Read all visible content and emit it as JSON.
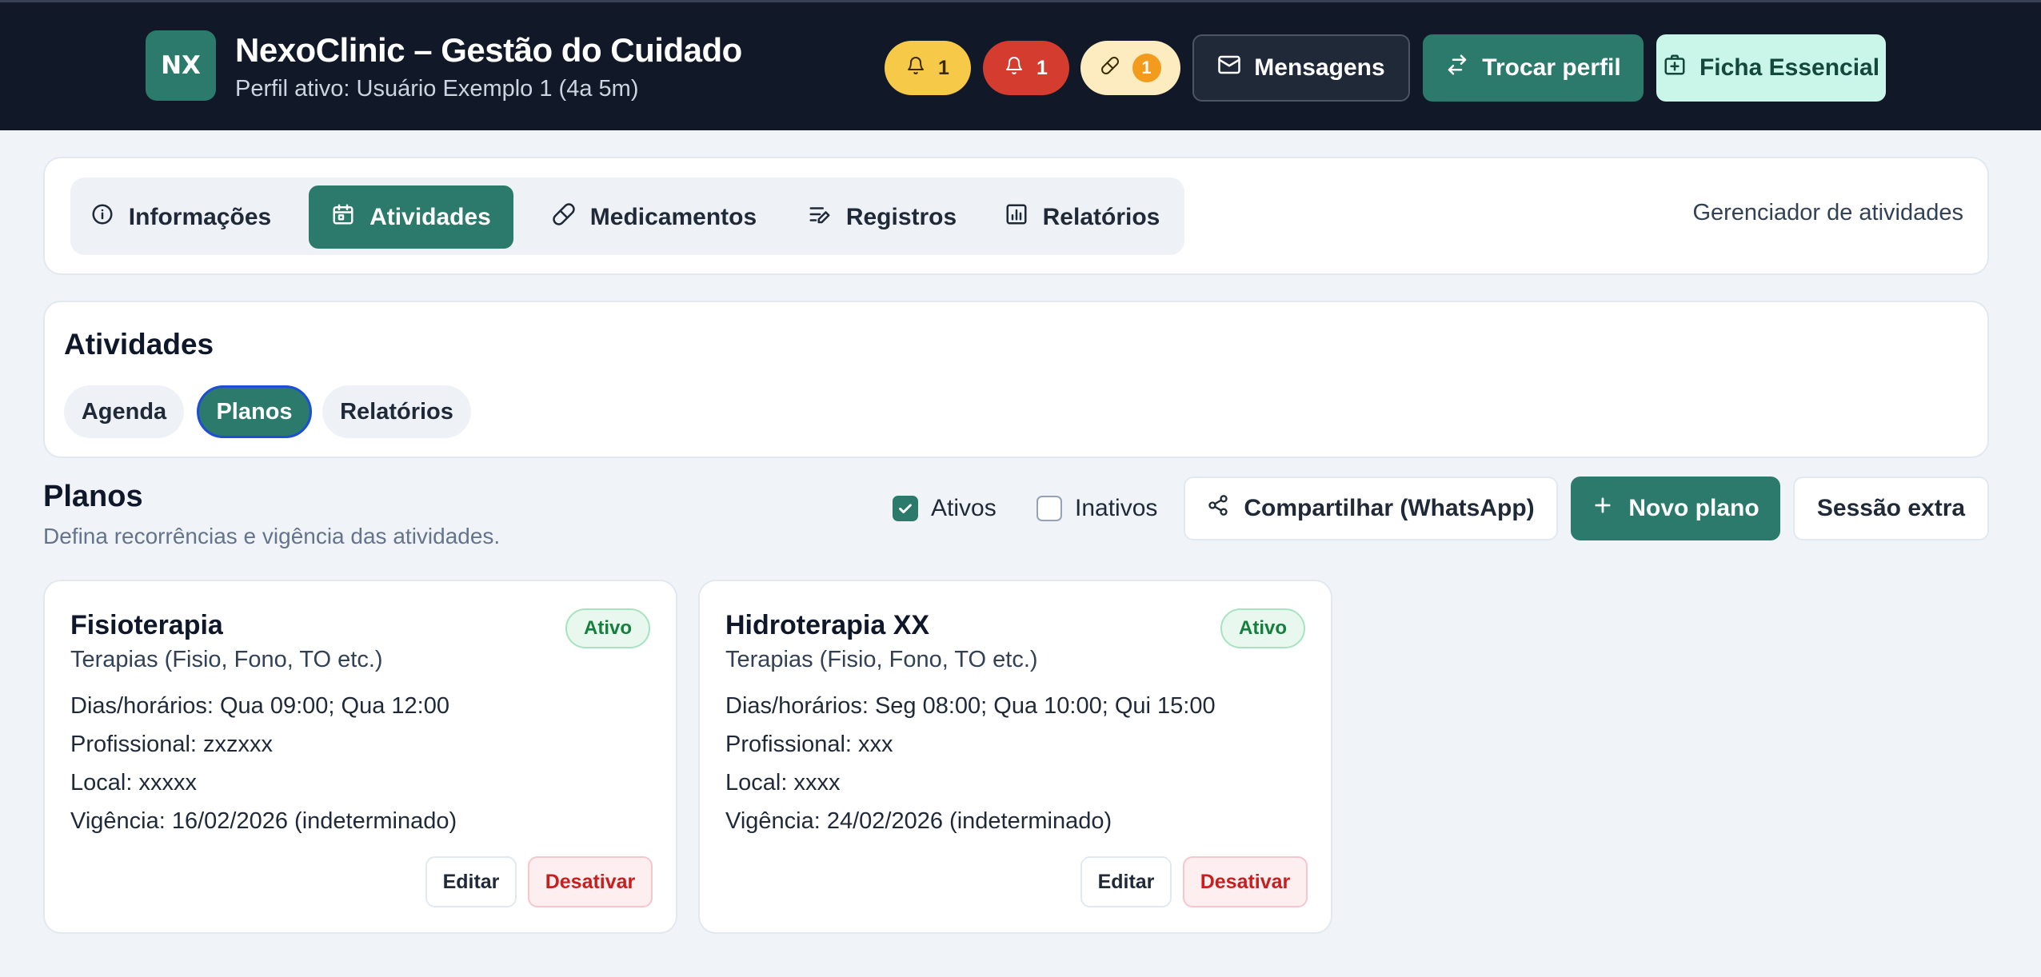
{
  "header": {
    "logo_text": "NX",
    "title": "NexoClinic – Gestão do Cuidado",
    "subtitle": "Perfil ativo: Usuário Exemplo 1 (4a 5m)",
    "alerts": [
      {
        "icon": "bell-icon",
        "count": "1",
        "color": "#f7c948"
      },
      {
        "icon": "bell-icon",
        "count": "1",
        "color": "#d43c30"
      },
      {
        "icon": "pill-icon",
        "count": "1",
        "color": "#fdecc0"
      }
    ],
    "messages_label": "Mensagens",
    "switch_profile_label": "Trocar perfil",
    "essential_sheet_label": "Ficha Essencial"
  },
  "nav": {
    "tabs": [
      {
        "label": "Informações",
        "icon": "info-icon"
      },
      {
        "label": "Atividades",
        "icon": "calendar-icon",
        "active": true
      },
      {
        "label": "Medicamentos",
        "icon": "pill-icon"
      },
      {
        "label": "Registros",
        "icon": "notes-icon"
      },
      {
        "label": "Relatórios",
        "icon": "chart-icon"
      }
    ],
    "right_label": "Gerenciador de atividades"
  },
  "activities": {
    "title": "Atividades",
    "subtabs": [
      {
        "label": "Agenda"
      },
      {
        "label": "Planos",
        "active": true
      },
      {
        "label": "Relatórios"
      }
    ]
  },
  "plans_section": {
    "title": "Planos",
    "subtitle": "Defina recorrências e vigência das atividades.",
    "filter_active_label": "Ativos",
    "filter_active_checked": true,
    "filter_inactive_label": "Inativos",
    "filter_inactive_checked": false,
    "share_label": "Compartilhar (WhatsApp)",
    "new_plan_label": "Novo plano",
    "extra_session_label": "Sessão extra"
  },
  "plans": [
    {
      "name": "Fisioterapia",
      "category": "Terapias (Fisio, Fono, TO etc.)",
      "status": "Ativo",
      "schedule": "Dias/horários: Qua 09:00; Qua 12:00",
      "professional": "Profissional: zxzxxx",
      "location": "Local: xxxxx",
      "validity": "Vigência: 16/02/2026 (indeterminado)",
      "edit_label": "Editar",
      "deactivate_label": "Desativar"
    },
    {
      "name": "Hidroterapia XX",
      "category": "Terapias (Fisio, Fono, TO etc.)",
      "status": "Ativo",
      "schedule": "Dias/horários: Seg 08:00; Qua 10:00; Qui 15:00",
      "professional": "Profissional: xxx",
      "location": "Local: xxxx",
      "validity": "Vigência: 24/02/2026 (indeterminado)",
      "edit_label": "Editar",
      "deactivate_label": "Desativar"
    }
  ],
  "colors": {
    "brand": "#2b7a6b",
    "header_bg": "#111827",
    "danger": "#c81e1e",
    "success": "#15803d"
  }
}
